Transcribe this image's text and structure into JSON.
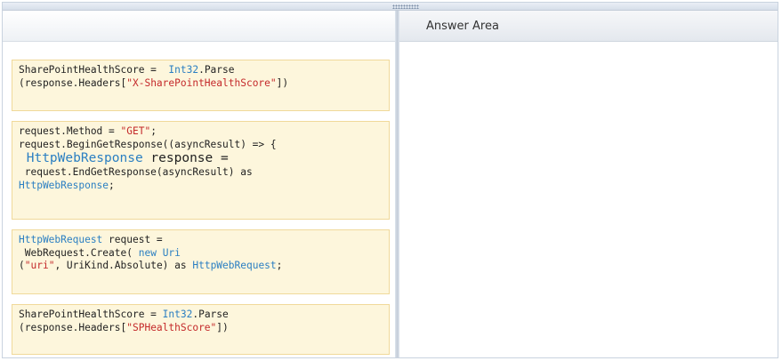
{
  "answer_area": {
    "title": "Answer Area"
  },
  "snippets": [
    {
      "lines": [
        [
          {
            "t": "SharePointHealthScore =  ",
            "c": ""
          },
          {
            "t": "Int32",
            "c": "kw"
          },
          {
            "t": ".Parse",
            "c": ""
          }
        ],
        [
          {
            "t": "(response.Headers[",
            "c": ""
          },
          {
            "t": "\"X-SharePointHealthScore\"",
            "c": "str"
          },
          {
            "t": "])",
            "c": ""
          }
        ]
      ]
    },
    {
      "lines": [
        [
          {
            "t": "request.Method = ",
            "c": ""
          },
          {
            "t": "\"GET\"",
            "c": "str"
          },
          {
            "t": ";",
            "c": ""
          }
        ],
        [
          {
            "t": "request.BeginGetResponse((asyncResult) => {",
            "c": ""
          }
        ],
        [
          {
            "t": " HttpWebResponse",
            "c": "kw big"
          },
          {
            "t": " response =",
            "c": "big"
          }
        ],
        [
          {
            "t": " request.EndGetResponse(asyncResult) as",
            "c": ""
          }
        ],
        [
          {
            "t": "HttpWebResponse",
            "c": "kw"
          },
          {
            "t": ";",
            "c": ""
          }
        ]
      ]
    },
    {
      "lines": [
        [
          {
            "t": "HttpWebRequest",
            "c": "kw"
          },
          {
            "t": " request =",
            "c": ""
          }
        ],
        [
          {
            "t": " WebRequest.Create( ",
            "c": ""
          },
          {
            "t": "new",
            "c": "kw"
          },
          {
            "t": " ",
            "c": ""
          },
          {
            "t": "Uri",
            "c": "kw"
          }
        ],
        [
          {
            "t": "(",
            "c": ""
          },
          {
            "t": "\"uri\"",
            "c": "str"
          },
          {
            "t": ", UriKind.Absolute) as ",
            "c": ""
          },
          {
            "t": "HttpWebRequest",
            "c": "kw"
          },
          {
            "t": ";",
            "c": ""
          }
        ]
      ]
    },
    {
      "lines": [
        [
          {
            "t": "SharePointHealthScore = ",
            "c": ""
          },
          {
            "t": "Int32",
            "c": "kw"
          },
          {
            "t": ".Parse",
            "c": ""
          }
        ],
        [
          {
            "t": "(response.Headers[",
            "c": ""
          },
          {
            "t": "\"SPHealthScore\"",
            "c": "str"
          },
          {
            "t": "])",
            "c": ""
          }
        ]
      ]
    }
  ]
}
